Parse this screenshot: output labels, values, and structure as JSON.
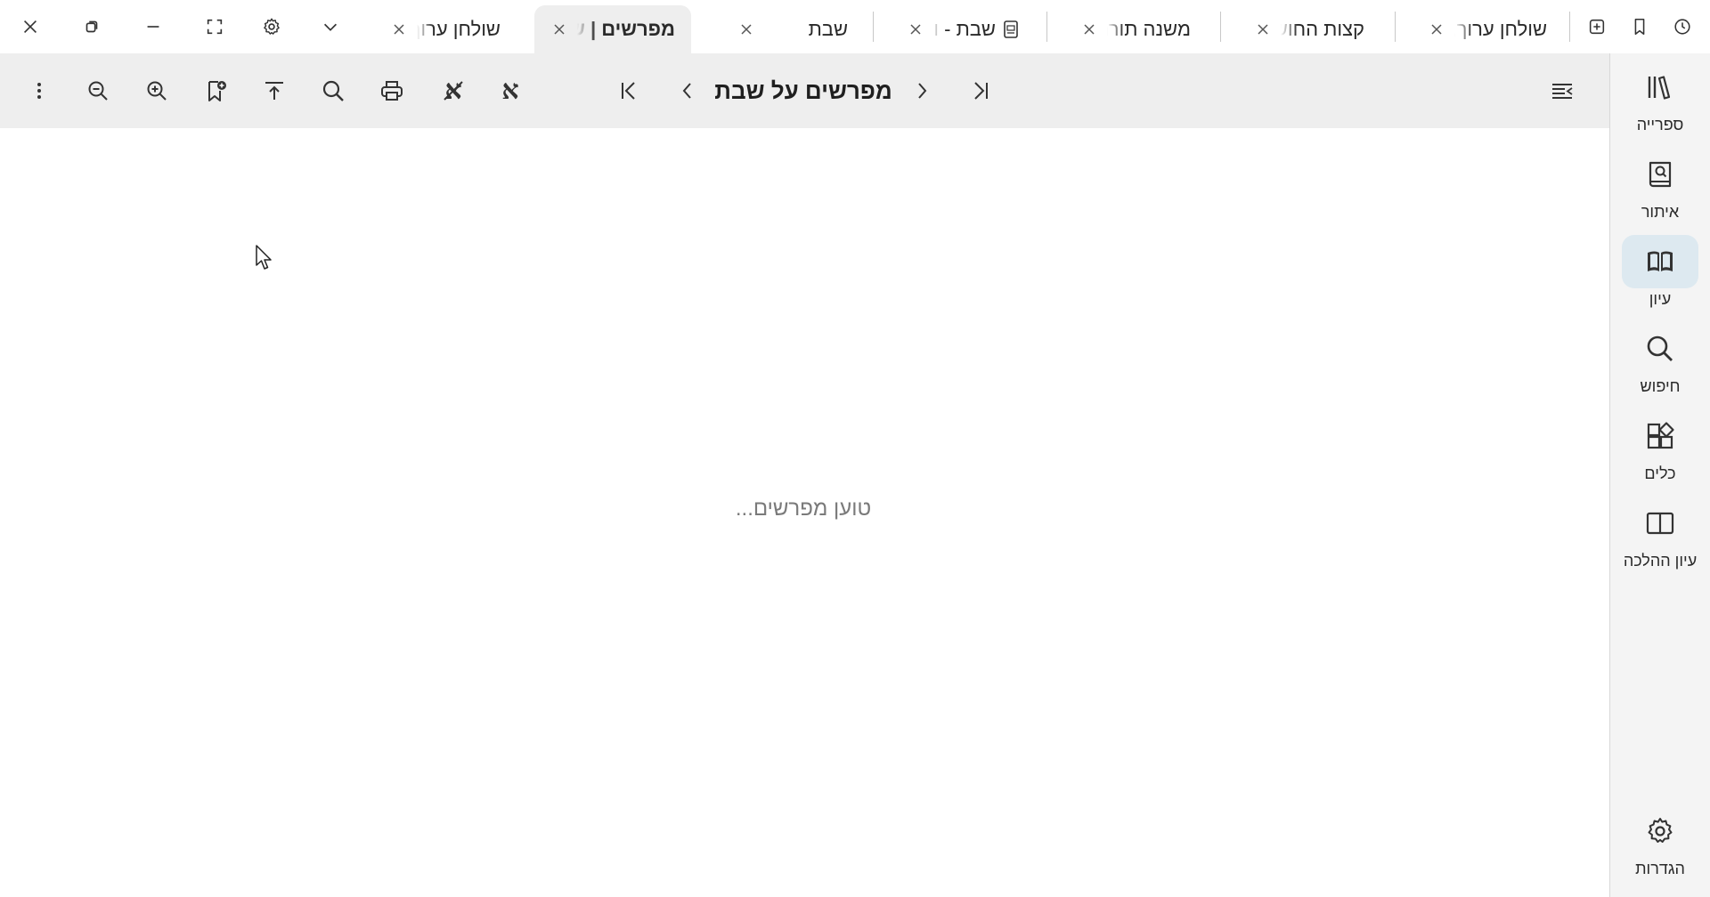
{
  "window_controls": {
    "close": "close-icon",
    "restore": "restore-icon",
    "minimize": "minimize-icon",
    "fullscreen": "fullscreen-icon",
    "settings": "gear-icon",
    "tabs_menu": "chevron-down-icon"
  },
  "tabs": [
    {
      "title": "שולחן ערוך, א",
      "active": false
    },
    {
      "title": "קצות החושן",
      "active": false
    },
    {
      "title": "משנה תורה,",
      "active": false
    },
    {
      "title": "שבת - וג",
      "active": false,
      "icon": "pdf-icon"
    },
    {
      "title": "שבת",
      "active": false
    },
    {
      "title": "מפרשים | ש",
      "active": true
    },
    {
      "title": "שולחן ערוך,",
      "active": false
    }
  ],
  "tabbar_right_icons": [
    "history-icon",
    "bookmark-icon",
    "new-tab-icon"
  ],
  "toolbar": {
    "title": "מפרשים על שבת",
    "icons": [
      "more-vertical-icon",
      "zoom-out-icon",
      "zoom-in-icon",
      "add-bookmark-icon",
      "scroll-to-top-icon",
      "search-icon",
      "print-icon",
      "nikud-off-icon",
      "nikud-icon",
      "first-page-icon",
      "previous-icon",
      "next-icon",
      "last-page-icon",
      "toc-icon"
    ],
    "alef_glyph": "א"
  },
  "content": {
    "loading_text": "טוען מפרשים..."
  },
  "nav_rail": {
    "items": [
      {
        "label": "ספרייה",
        "icon": "library-icon",
        "active": false
      },
      {
        "label": "איתור",
        "icon": "find-book-icon",
        "active": false
      },
      {
        "label": "עיון",
        "icon": "open-book-icon",
        "active": true
      },
      {
        "label": "חיפוש",
        "icon": "search-icon",
        "active": false
      },
      {
        "label": "כלים",
        "icon": "tools-icon",
        "active": false
      },
      {
        "label": "עיון ההלכה",
        "icon": "split-view-icon",
        "active": false
      }
    ],
    "settings": {
      "label": "הגדרות",
      "icon": "gear-icon"
    }
  },
  "colors": {
    "toolbar_bg": "#eeeeee",
    "active_tab_bg": "#eeeeee",
    "rail_bg": "#f4f4f4",
    "rail_active_bg": "#dde9f0",
    "loading_text": "#7a7a7a"
  }
}
